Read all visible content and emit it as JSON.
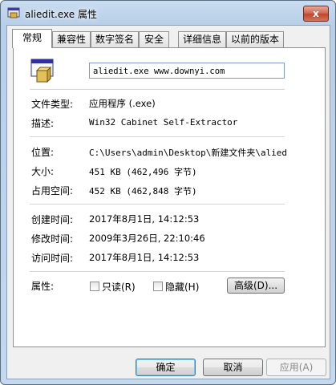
{
  "window": {
    "title": "aliedit.exe 属性",
    "close_label": "x"
  },
  "tabs": [
    {
      "label": "常规",
      "active": true
    },
    {
      "label": "兼容性"
    },
    {
      "label": "数字签名"
    },
    {
      "label": "安全"
    },
    {
      "label": "详细信息"
    },
    {
      "label": "以前的版本"
    }
  ],
  "general": {
    "filename": "aliedit.exe www.downyi.com",
    "fields": {
      "type": {
        "label": "文件类型:",
        "value": "应用程序 (.exe)"
      },
      "description": {
        "label": "描述:",
        "value": "Win32 Cabinet Self-Extractor"
      },
      "location": {
        "label": "位置:",
        "value": "C:\\Users\\admin\\Desktop\\新建文件夹\\aliedit"
      },
      "size": {
        "label": "大小:",
        "value": "451 KB (462,496 字节)"
      },
      "size_on_disk": {
        "label": "占用空间:",
        "value": "452 KB (462,848 字节)"
      },
      "created": {
        "label": "创建时间:",
        "value": "2017年8月1日, 14:12:53"
      },
      "modified": {
        "label": "修改时间:",
        "value": "2009年3月26日, 22:10:46"
      },
      "accessed": {
        "label": "访问时间:",
        "value": "2017年8月1日, 14:12:53"
      }
    },
    "attributes": {
      "label": "属性:",
      "readonly": "只读(R)",
      "hidden": "隐藏(H)",
      "advanced": "高级(D)..."
    }
  },
  "buttons": {
    "ok": "确定",
    "cancel": "取消",
    "apply": "应用(A)"
  }
}
